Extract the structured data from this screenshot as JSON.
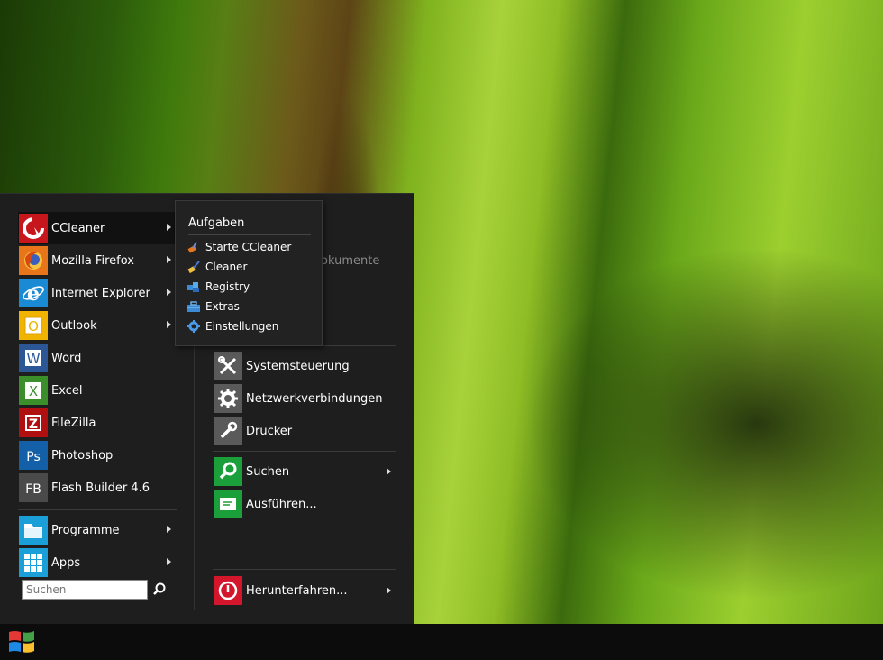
{
  "left_menu": {
    "items": [
      {
        "label": "CCleaner",
        "has_arrow": true,
        "active": true
      },
      {
        "label": "Mozilla Firefox",
        "has_arrow": true
      },
      {
        "label": "Internet Explorer",
        "has_arrow": true
      },
      {
        "label": "Outlook",
        "has_arrow": true
      },
      {
        "label": "Word"
      },
      {
        "label": "Excel"
      },
      {
        "label": "FileZilla"
      },
      {
        "label": "Photoshop"
      },
      {
        "label": "Flash Builder 4.6"
      }
    ],
    "programs_label": "Programme",
    "apps_label": "Apps",
    "search_placeholder": "Suchen"
  },
  "right_menu": {
    "peek_1": "Dokumente",
    "items": [
      {
        "label": "Systemsteuerung"
      },
      {
        "label": "Netzwerkverbindungen"
      },
      {
        "label": "Drucker"
      },
      {
        "label": "Suchen",
        "has_arrow": true
      },
      {
        "label": "Ausführen..."
      },
      {
        "label": "Herunterfahren...",
        "has_arrow": true
      }
    ]
  },
  "jumplist": {
    "title": "Aufgaben",
    "items": [
      {
        "label": "Starte CCleaner"
      },
      {
        "label": "Cleaner"
      },
      {
        "label": "Registry"
      },
      {
        "label": "Extras"
      },
      {
        "label": "Einstellungen"
      }
    ]
  },
  "colors": {
    "menu_bg": "#1e1e1e",
    "taskbar_bg": "#0c0c0c",
    "ccleaner_red": "#c8161d",
    "firefox_orange": "#e8751a",
    "ie_blue": "#1a8ad4",
    "outlook_yellow": "#f0b400",
    "word_blue": "#2b5797",
    "excel_green": "#3a8f2a",
    "filezilla_red": "#b01010",
    "photoshop_blue": "#1460a8",
    "flash_gray": "#4a4a4a",
    "programs_blue": "#1a9fd8",
    "apps_blue": "#1a9fd8",
    "tools_gray": "#5a5a5a",
    "search_green": "#1a9f3a",
    "run_green": "#1a9f3a",
    "shutdown_red": "#d3162c"
  }
}
